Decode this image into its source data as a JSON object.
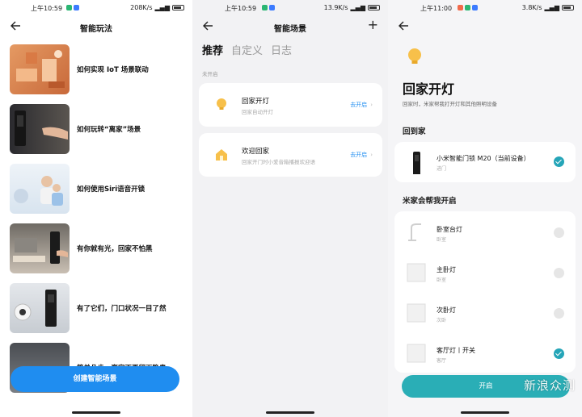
{
  "panel1": {
    "status": {
      "time": "上午10:59",
      "net": "208K/s",
      "battery": "89"
    },
    "title": "智能玩法",
    "tips": [
      {
        "label": "如何实现 IoT 场景联动"
      },
      {
        "label": "如何玩转“离家”场景"
      },
      {
        "label": "如何使用Siri语音开锁"
      },
      {
        "label": "有你就有光，回家不怕黑"
      },
      {
        "label": "有了它们，门口状况一目了然"
      },
      {
        "label": "简单几步，离家不再留下隐患"
      }
    ],
    "cta": "创建智能场景"
  },
  "panel2": {
    "status": {
      "time": "上午10:59",
      "net": "13.9K/s",
      "battery": "89"
    },
    "title": "智能场景",
    "add": "+",
    "tabs": [
      "推荐",
      "自定义",
      "日志"
    ],
    "section_hint": "未开启",
    "scenes": [
      {
        "name": "回家开灯",
        "desc": "回家自动开灯",
        "action": "去开启",
        "icon": "bulb-icon"
      },
      {
        "name": "欢迎回家",
        "desc": "回家开门时小爱音箱播报欢迎语",
        "action": "去开启",
        "icon": "home-icon"
      }
    ]
  },
  "panel3": {
    "status": {
      "time": "上午11:00",
      "net": "3.8K/s",
      "battery": "89"
    },
    "title": "回家开灯",
    "subtitle": "回家时，米家帮我打开灯和其他照明设备",
    "trigger_section": "回到家",
    "trigger_device": {
      "name": "小米智能门锁 M20（当前设备）",
      "room": "进门",
      "checked": true
    },
    "help_section": "米家会帮我开启",
    "devices": [
      {
        "name": "卧室台灯",
        "room": "卧室",
        "checked": false,
        "icon": "desk-lamp-icon"
      },
      {
        "name": "主卧灯",
        "room": "卧室",
        "checked": false,
        "icon": "wall-switch-icon"
      },
      {
        "name": "次卧灯",
        "room": "次卧",
        "checked": false,
        "icon": "wall-switch-icon"
      },
      {
        "name": "客厅灯丨开关",
        "room": "客厅",
        "checked": true,
        "icon": "wall-switch-icon"
      }
    ],
    "open_button": "开启",
    "watermark": "新浪众测"
  },
  "colors": {
    "accent_blue": "#1f8df0",
    "accent_teal": "#2aaeb6",
    "check_teal": "#25a5b8",
    "bulb_yellow": "#f7c04a"
  }
}
